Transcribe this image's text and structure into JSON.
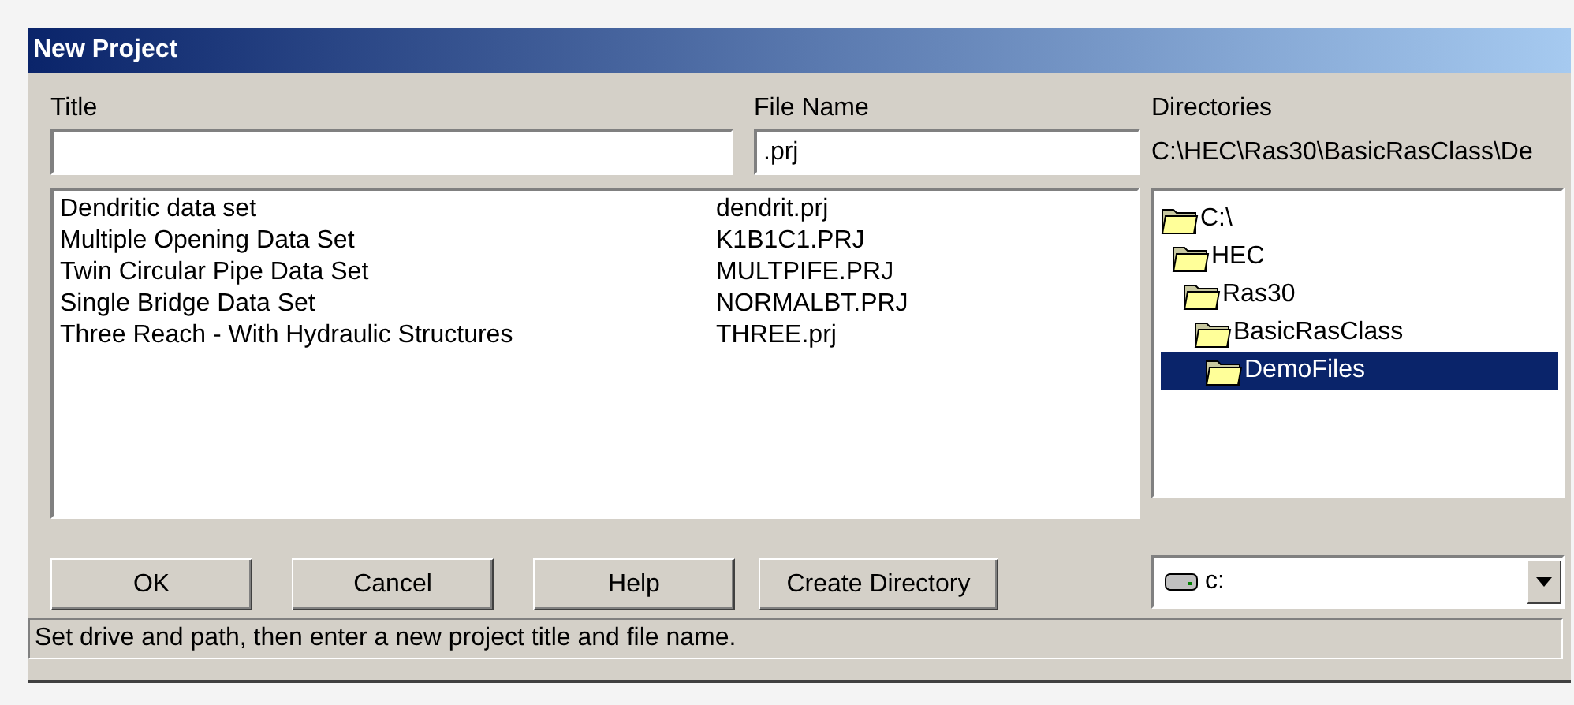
{
  "window": {
    "title": "New Project"
  },
  "title_field": {
    "label": "Title"
  },
  "file_name_field": {
    "label": "File Name",
    "value": ".prj"
  },
  "directories": {
    "label": "Directories",
    "path": "C:\\HEC\\Ras30\\BasicRasClass\\De",
    "tree": [
      {
        "label": "C:\\",
        "selected": false,
        "children": [
          {
            "label": "HEC",
            "selected": false,
            "children": [
              {
                "label": "Ras30",
                "selected": false,
                "children": [
                  {
                    "label": "BasicRasClass",
                    "selected": false,
                    "children": [
                      {
                        "label": "DemoFiles",
                        "selected": true
                      }
                    ]
                  }
                ]
              }
            ]
          }
        ]
      }
    ],
    "drive": "c:"
  },
  "projects": [
    {
      "title": "Dendritic data set",
      "file": "dendrit.prj",
      "selected": false
    },
    {
      "title": "Multiple Opening Data Set",
      "file": "K1B1C1.PRJ",
      "selected": false
    },
    {
      "title": "Twin Circular Pipe Data Set",
      "file": "MULTPIFE.PRJ",
      "selected": false
    },
    {
      "title": "Single Bridge Data Set",
      "file": "NORMALBT.PRJ",
      "selected": false
    },
    {
      "title": "Three Reach - With Hydraulic Structures",
      "file": "THREE.prj",
      "selected": false
    }
  ],
  "buttons": [
    "OK",
    "Cancel",
    "Help",
    "Create Directory"
  ],
  "status_bar": "Set drive and path, then enter a new project title and file name."
}
